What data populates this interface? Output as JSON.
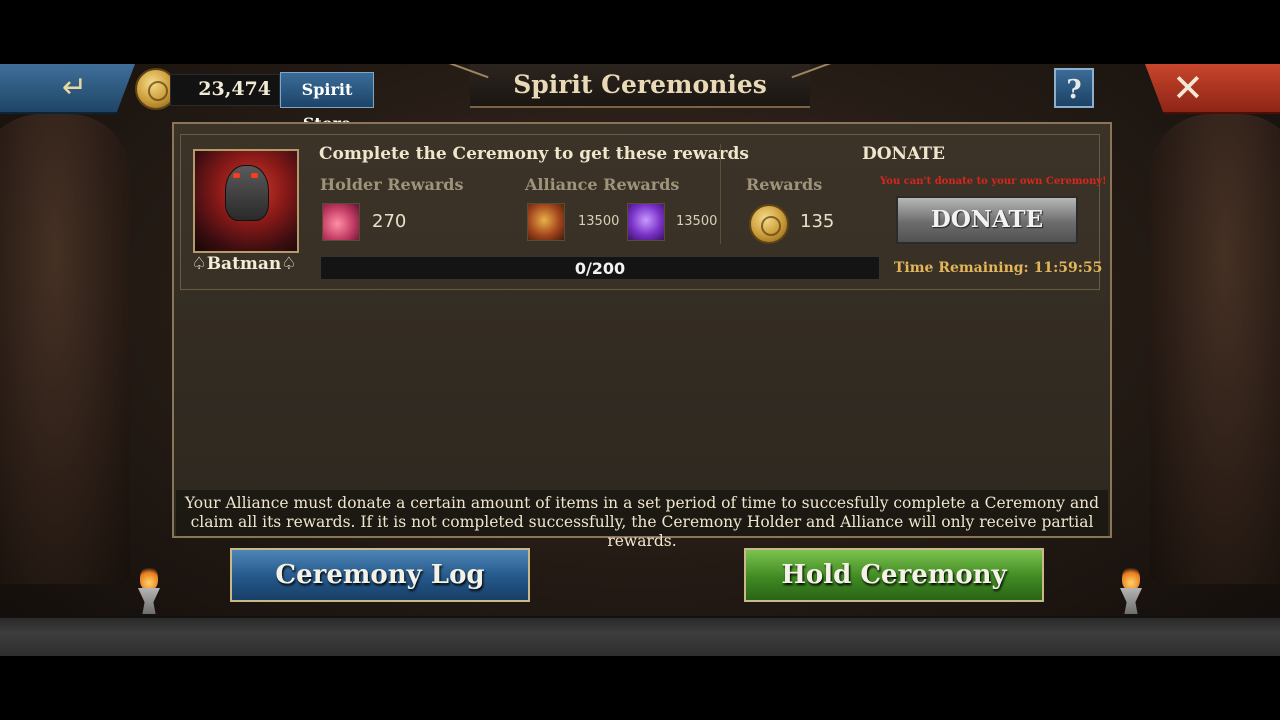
{
  "topbar": {
    "back_icon": "↵",
    "currency_amount": "23,474",
    "store_label": "Spirit Store",
    "title": "Spirit Ceremonies",
    "help_label": "?",
    "close_icon": "✕"
  },
  "ceremony": {
    "holder_name": "♤Batman♤",
    "heading": "Complete the Ceremony to get these rewards",
    "holder_rewards_label": "Holder Rewards",
    "holder_reward_amount": "270",
    "alliance_rewards_label": "Alliance Rewards",
    "alliance_reward_1": "13500",
    "alliance_reward_2": "13500",
    "donate_heading": "DONATE",
    "rewards_label": "Rewards",
    "rewards_amount": "135",
    "warning": "You can't donate to your own Ceremony!",
    "donate_button": "DONATE",
    "progress_text": "0/200",
    "progress_fraction": 0,
    "time_remaining": "Time Remaining: 11:59:55"
  },
  "info_text": "Your Alliance must donate a certain amount of items in a set period of time to succesfully complete a Ceremony and claim all its rewards. If it is not completed successfully, the Ceremony Holder and Alliance will only receive partial rewards.",
  "buttons": {
    "log": "Ceremony Log",
    "hold": "Hold Ceremony"
  }
}
